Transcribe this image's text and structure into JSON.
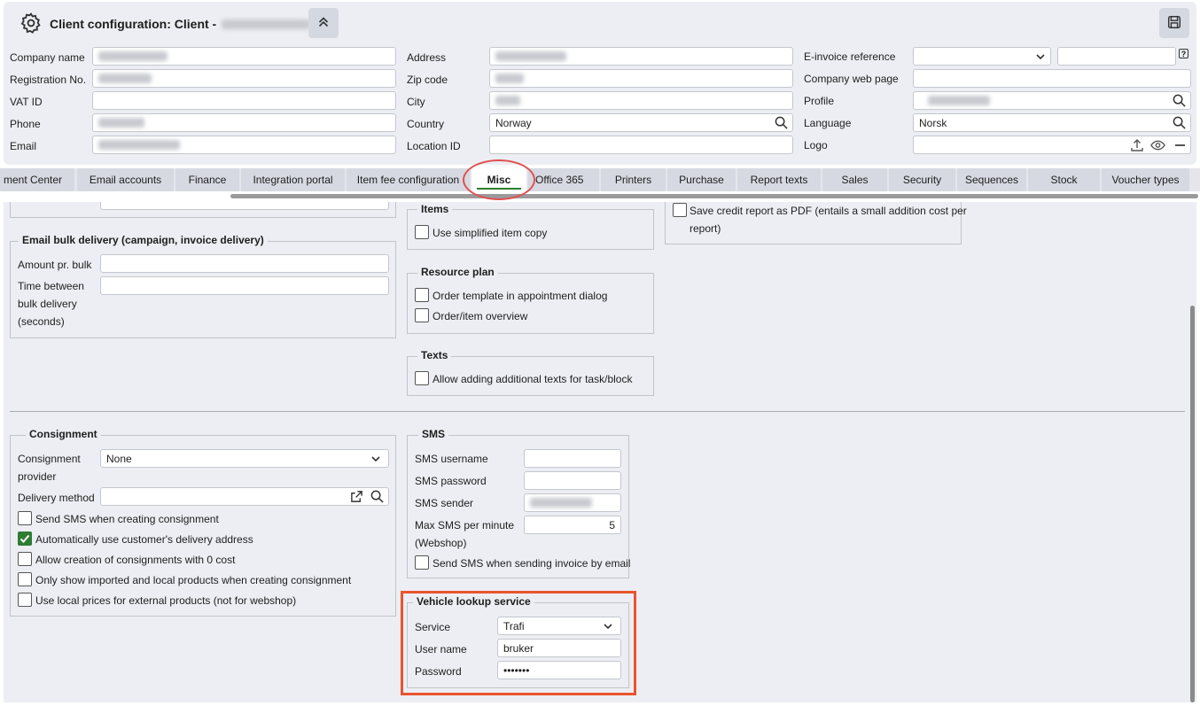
{
  "header": {
    "title": "Client configuration: Client -",
    "left_fields": [
      {
        "label": "Company name",
        "value": ""
      },
      {
        "label": "Registration No.",
        "value": ""
      },
      {
        "label": "VAT ID",
        "value": ""
      },
      {
        "label": "Phone",
        "value": ""
      },
      {
        "label": "Email",
        "value": ""
      }
    ],
    "mid_fields": [
      {
        "label": "Address",
        "value": ""
      },
      {
        "label": "Zip code",
        "value": ""
      },
      {
        "label": "City",
        "value": ""
      },
      {
        "label": "Country",
        "value": "Norway"
      },
      {
        "label": "Location ID",
        "value": ""
      }
    ],
    "right_fields": [
      {
        "label": "E-invoice reference",
        "value": ""
      },
      {
        "label": "Company web page",
        "value": ""
      },
      {
        "label": "Profile",
        "value": ""
      },
      {
        "label": "Language",
        "value": "Norsk"
      },
      {
        "label": "Logo",
        "value": ""
      }
    ],
    "help_glyph": "?"
  },
  "tabs": [
    {
      "label": "ment Center"
    },
    {
      "label": "Email accounts"
    },
    {
      "label": "Finance"
    },
    {
      "label": "Integration portal"
    },
    {
      "label": "Item fee configuration"
    },
    {
      "label": "Misc",
      "active": true
    },
    {
      "label": "Office 365"
    },
    {
      "label": "Printers"
    },
    {
      "label": "Purchase"
    },
    {
      "label": "Report texts"
    },
    {
      "label": "Sales"
    },
    {
      "label": "Security"
    },
    {
      "label": "Sequences"
    },
    {
      "label": "Stock"
    },
    {
      "label": "Voucher types"
    }
  ],
  "email_bulk": {
    "title": "Email bulk delivery (campaign, invoice delivery)",
    "amount_label": "Amount pr. bulk",
    "time_label_1": "Time between",
    "time_label_2": "bulk delivery",
    "time_label_3": "(seconds)"
  },
  "items": {
    "title": "Items",
    "simplified_copy": "Use simplified item copy"
  },
  "credit": {
    "line1": "Save credit report as PDF (entails a small addition cost per",
    "line2": "report)"
  },
  "resource_plan": {
    "title": "Resource plan",
    "opt1": "Order template in appointment dialog",
    "opt2": "Order/item overview"
  },
  "texts": {
    "title": "Texts",
    "opt1": "Allow adding additional texts for task/block"
  },
  "consignment": {
    "title": "Consignment",
    "provider_label_1": "Consignment",
    "provider_label_2": "provider",
    "provider_value": "None",
    "delivery_label": "Delivery method",
    "opt1": "Send SMS when creating consignment",
    "opt2": "Automatically use customer's delivery address",
    "opt3": "Allow creation of consignments with 0 cost",
    "opt4": "Only show imported and local products when creating consignment",
    "opt5": "Use local prices for external products (not for webshop)"
  },
  "sms": {
    "title": "SMS",
    "username_label": "SMS username",
    "password_label": "SMS password",
    "sender_label": "SMS sender",
    "max_label_1": "Max SMS per minute",
    "max_label_2": "(Webshop)",
    "max_value": "5",
    "opt1": "Send SMS when sending invoice by email"
  },
  "vehicle": {
    "title": "Vehicle lookup service",
    "service_label": "Service",
    "service_value": "Trafi",
    "username_label": "User name",
    "username_value": "bruker",
    "password_label": "Password",
    "password_value": "•••••••"
  },
  "colors": {
    "accent_green": "#2e7d32",
    "highlight_red": "#e15050",
    "highlight_orange": "#e8552e"
  }
}
